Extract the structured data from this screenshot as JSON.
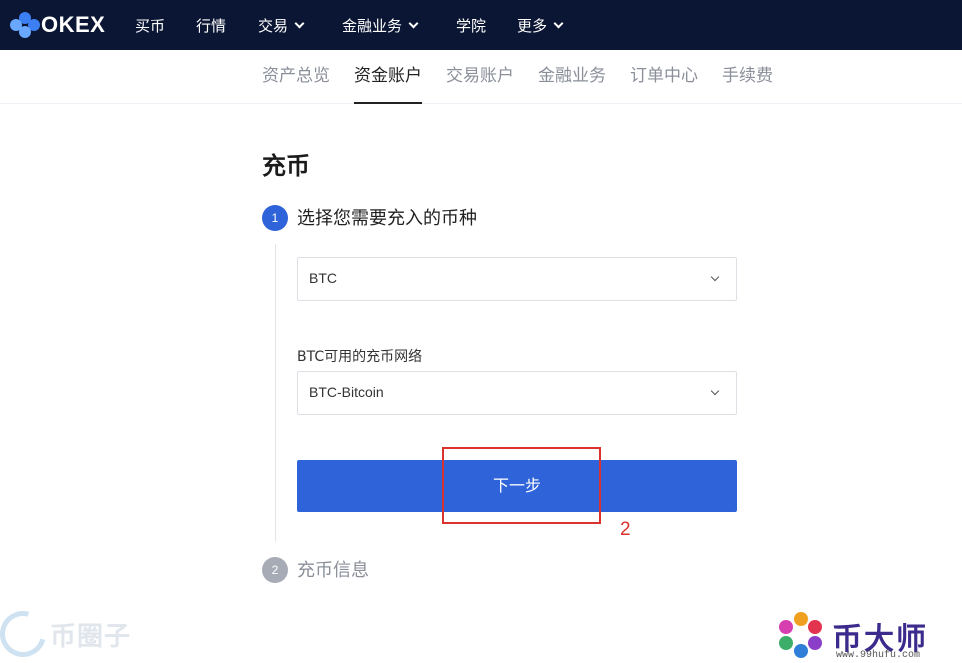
{
  "brand": {
    "logo_text": "OKEX"
  },
  "topnav": {
    "items": [
      {
        "label": "买币"
      },
      {
        "label": "行情"
      },
      {
        "label": "交易",
        "has_dropdown": true
      },
      {
        "label": "金融业务",
        "has_dropdown": true
      },
      {
        "label": "学院"
      },
      {
        "label": "更多",
        "has_dropdown": true
      }
    ]
  },
  "subnav": {
    "active": "资金账户",
    "items": [
      "资产总览",
      "资金账户",
      "交易账户",
      "金融业务",
      "订单中心",
      "手续费"
    ]
  },
  "page": {
    "title": "充币"
  },
  "step1": {
    "number": "1",
    "title": "选择您需要充入的币种",
    "coin_select": {
      "value": "BTC"
    },
    "network_label": "BTC可用的充币网络",
    "network_select": {
      "value": "BTC-Bitcoin"
    },
    "next_button": "下一步"
  },
  "step2": {
    "number": "2",
    "title": "充币信息"
  },
  "annotation": {
    "number": "2",
    "color": "#d9322f"
  },
  "colors": {
    "topbar": "#0a1633",
    "primary": "#2f63d9",
    "step_inactive": "#a6abb5"
  },
  "watermarks": {
    "left_text": "币圈子",
    "right_text": "币大师",
    "right_url": "www.99hufu.com"
  }
}
